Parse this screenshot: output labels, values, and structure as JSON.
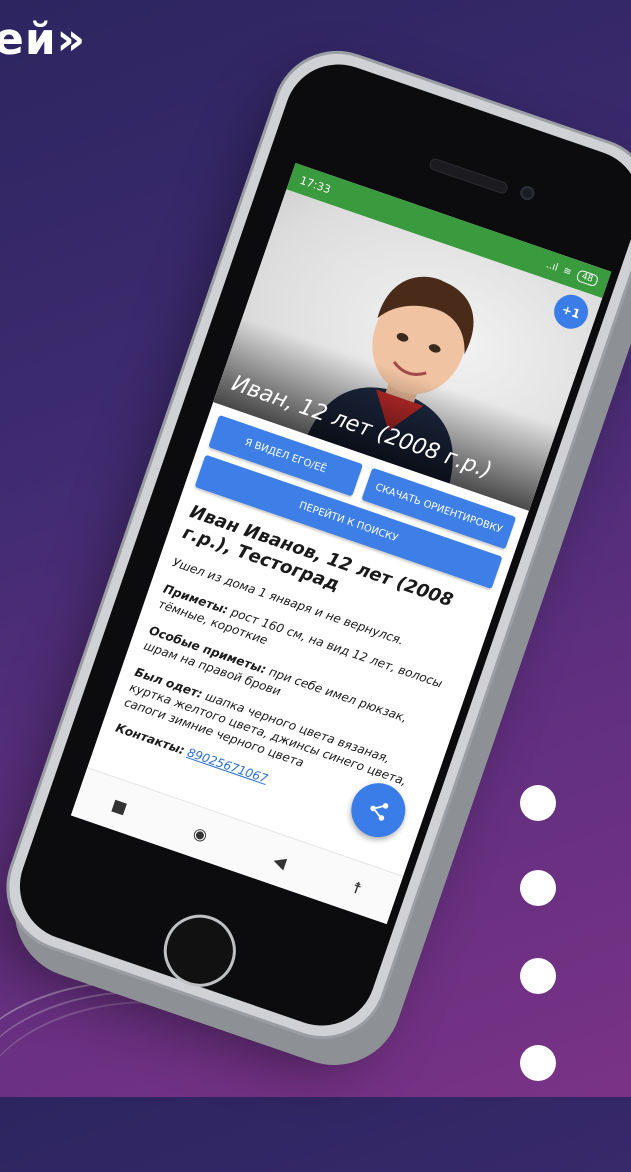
{
  "slide": {
    "headline_fragment": "ей»"
  },
  "phone": {
    "status": {
      "time": "17:33",
      "signal": "..ıl",
      "wifi": "≋",
      "battery": "48"
    },
    "hero": {
      "badge": "+1",
      "caption": "Иван, 12 лет (2008 г.р.)"
    },
    "buttons": {
      "seen": "Я видел его/её",
      "download": "Скачать ориентировку",
      "search": "Перейти к поиску"
    },
    "card": {
      "title": "Иван Иванов, 12 лет (2008 г.р.), Тестоград",
      "left_home": "Ушел из дома 1 января и не вернулся.",
      "signs_label": "Приметы:",
      "signs_text": "рост 160 см, на вид 12 лет, волосы тёмные, короткие",
      "special_label": "Особые приметы:",
      "special_text": "при себе имел рюкзак, шрам на правой брови",
      "clothes_label": "Был одет:",
      "clothes_text": "шапка черного цвета вязаная, куртка желтого цвета, джинсы синего цвета, сапоги зимние черного цвета",
      "contacts_label": "Контакты:",
      "contacts_value": "89025671067"
    },
    "icons": {
      "share": "share-icon",
      "nav_square": "stop-icon",
      "nav_home": "home-circle-icon",
      "nav_back": "back-triangle-icon",
      "nav_accessibility": "accessibility-icon"
    },
    "colors": {
      "status_bar": "#3a9a3e",
      "button": "#3d7fe6",
      "background_top": "#2c2560",
      "background_bottom": "#7a3286"
    }
  }
}
